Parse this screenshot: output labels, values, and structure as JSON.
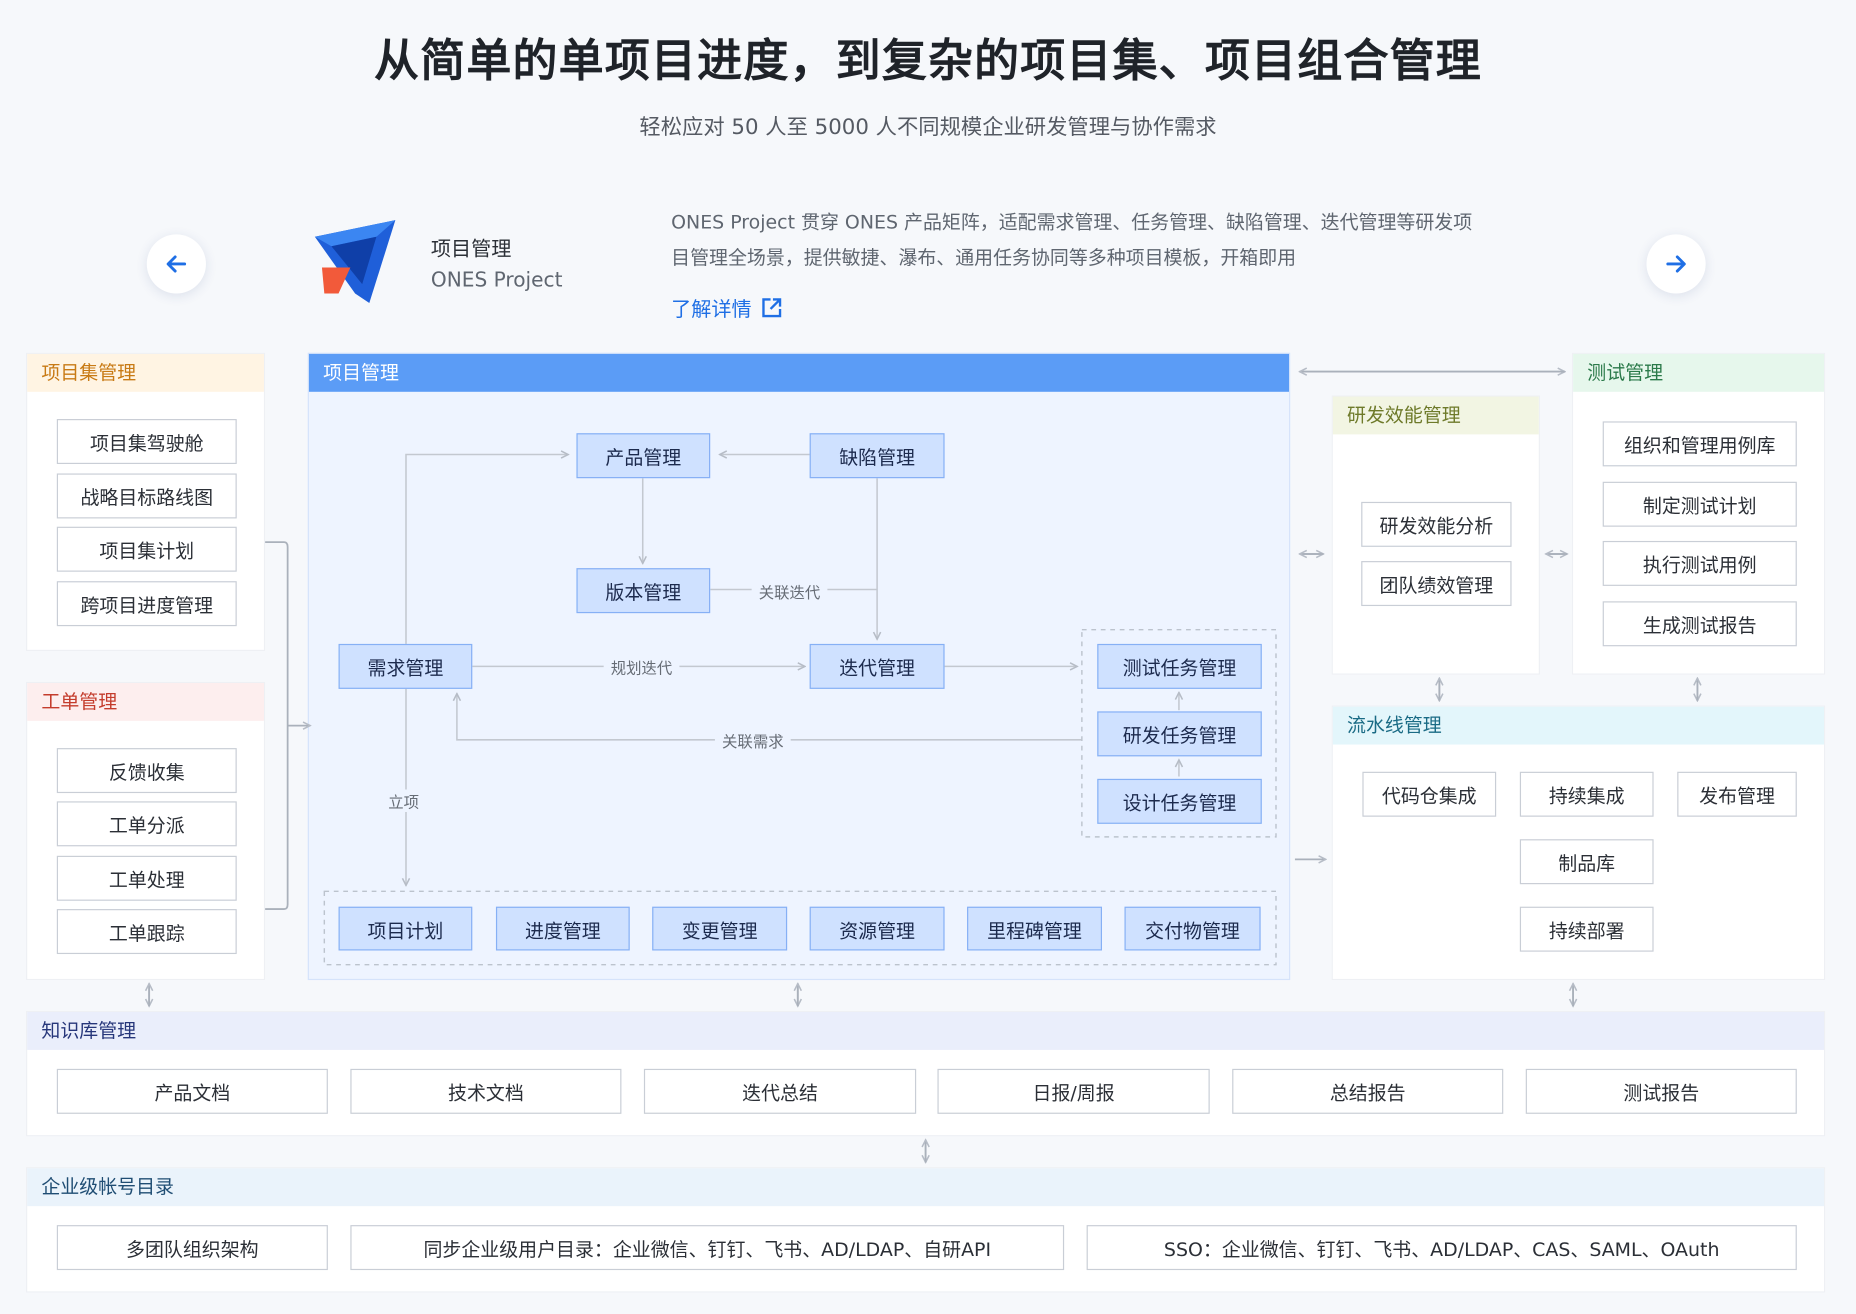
{
  "header": {
    "title": "从简单的单项目进度，到复杂的项目集、项目组合管理",
    "subtitle": "轻松应对 50 人至 5000 人不同规模企业研发管理与协作需求"
  },
  "product": {
    "name": "项目管理",
    "sub": "ONES Project",
    "desc_line1": "ONES Project 贯穿 ONES 产品矩阵，适配需求管理、任务管理、缺陷管理、迭代管理等研发项",
    "desc_line2": "目管理全场景，提供敏捷、瀑布、通用任务协同等多种项目模板，开箱即用",
    "link": "了解详情"
  },
  "nav": {
    "prev_icon": "arrow-left-icon",
    "next_icon": "arrow-right-icon"
  },
  "portfolio": {
    "title": "项目集管理",
    "items": [
      "项目集驾驶舱",
      "战略目标路线图",
      "项目集计划",
      "跨项目进度管理"
    ]
  },
  "ticket": {
    "title": "工单管理",
    "items": [
      "反馈收集",
      "工单分派",
      "工单处理",
      "工单跟踪"
    ]
  },
  "project": {
    "title": "项目管理",
    "product_mgmt": "产品管理",
    "defect_mgmt": "缺陷管理",
    "version_mgmt": "版本管理",
    "requirement_mgmt": "需求管理",
    "iteration_mgmt": "迭代管理",
    "test_task": "测试任务管理",
    "dev_task": "研发任务管理",
    "design_task": "设计任务管理",
    "label_link_iteration": "关联迭代",
    "label_plan_iteration": "规划迭代",
    "label_link_requirement": "关联需求",
    "label_initiate": "立项",
    "bottom_items": [
      "项目计划",
      "进度管理",
      "变更管理",
      "资源管理",
      "里程碑管理",
      "交付物管理"
    ]
  },
  "efficiency": {
    "title": "研发效能管理",
    "items": [
      "研发效能分析",
      "团队绩效管理"
    ]
  },
  "testing": {
    "title": "测试管理",
    "items": [
      "组织和管理用例库",
      "制定测试计划",
      "执行测试用例",
      "生成测试报告"
    ]
  },
  "pipeline": {
    "title": "流水线管理",
    "items": [
      "代码仓集成",
      "持续集成",
      "发布管理",
      "制品库",
      "持续部署"
    ]
  },
  "knowledge": {
    "title": "知识库管理",
    "items": [
      "产品文档",
      "技术文档",
      "迭代总结",
      "日报/周报",
      "总结报告",
      "测试报告"
    ]
  },
  "directory": {
    "title": "企业级帐号目录",
    "items": [
      "多团队组织架构",
      "同步企业级用户目录：企业微信、钉钉、飞书、AD/LDAP、自研API",
      "SSO：企业微信、钉钉、飞书、AD/LDAP、CAS、SAML、OAuth"
    ]
  },
  "colors": {
    "accent_blue": "#5b9cf6",
    "box_blue": "#cfe1ff",
    "portfolio_header": "#fff4e3",
    "ticket_header": "#fdeeee",
    "efficiency_header": "#f2f5e3",
    "testing_header": "#e6f7ec",
    "pipeline_header": "#e3f6fb",
    "knowledge_header": "#eaeefb",
    "directory_header": "#eaf3fb"
  }
}
